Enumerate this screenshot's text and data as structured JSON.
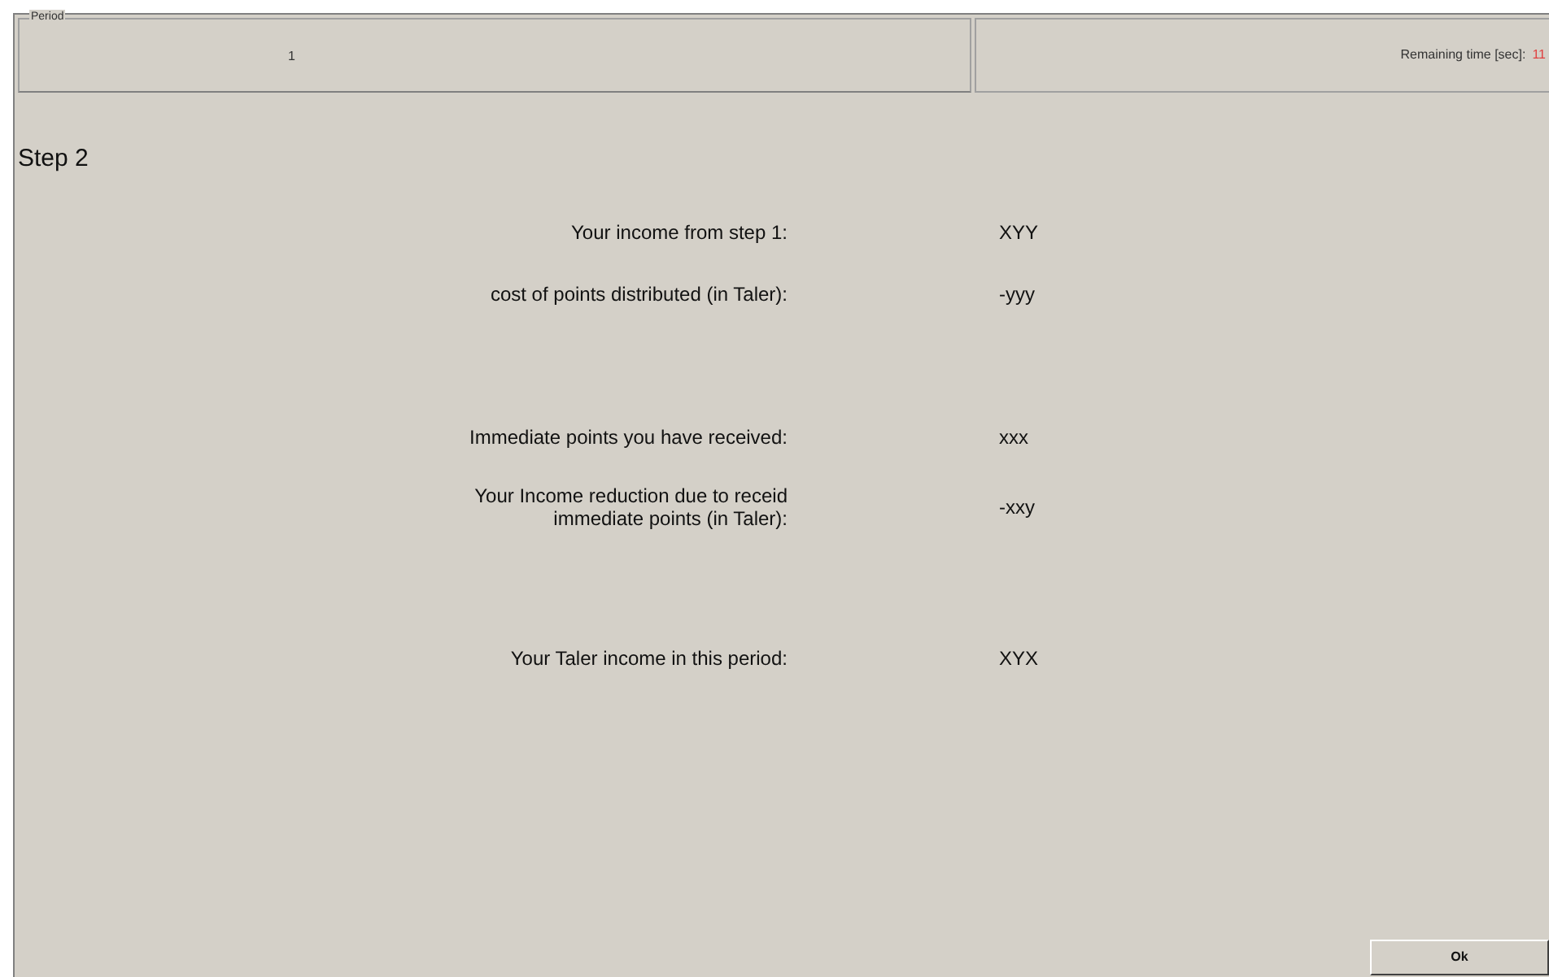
{
  "period": {
    "label": "Period",
    "value": "1"
  },
  "timer": {
    "label": "Remaining time [sec]:",
    "value": "11"
  },
  "step_title": "Step 2",
  "sections": [
    [
      {
        "label": "Your income from step 1:",
        "value": "XYY"
      },
      {
        "label": "cost of points distributed (in Taler):",
        "value": "-yyy"
      }
    ],
    [
      {
        "label": "Immediate points you have received:",
        "value": "xxx"
      },
      {
        "label": "Your Income reduction due to receid\nimmediate points (in Taler):",
        "value": "-xxy"
      }
    ],
    [
      {
        "label": "Your Taler income in this period:",
        "value": "XYX"
      }
    ]
  ],
  "ok_button": "Ok"
}
